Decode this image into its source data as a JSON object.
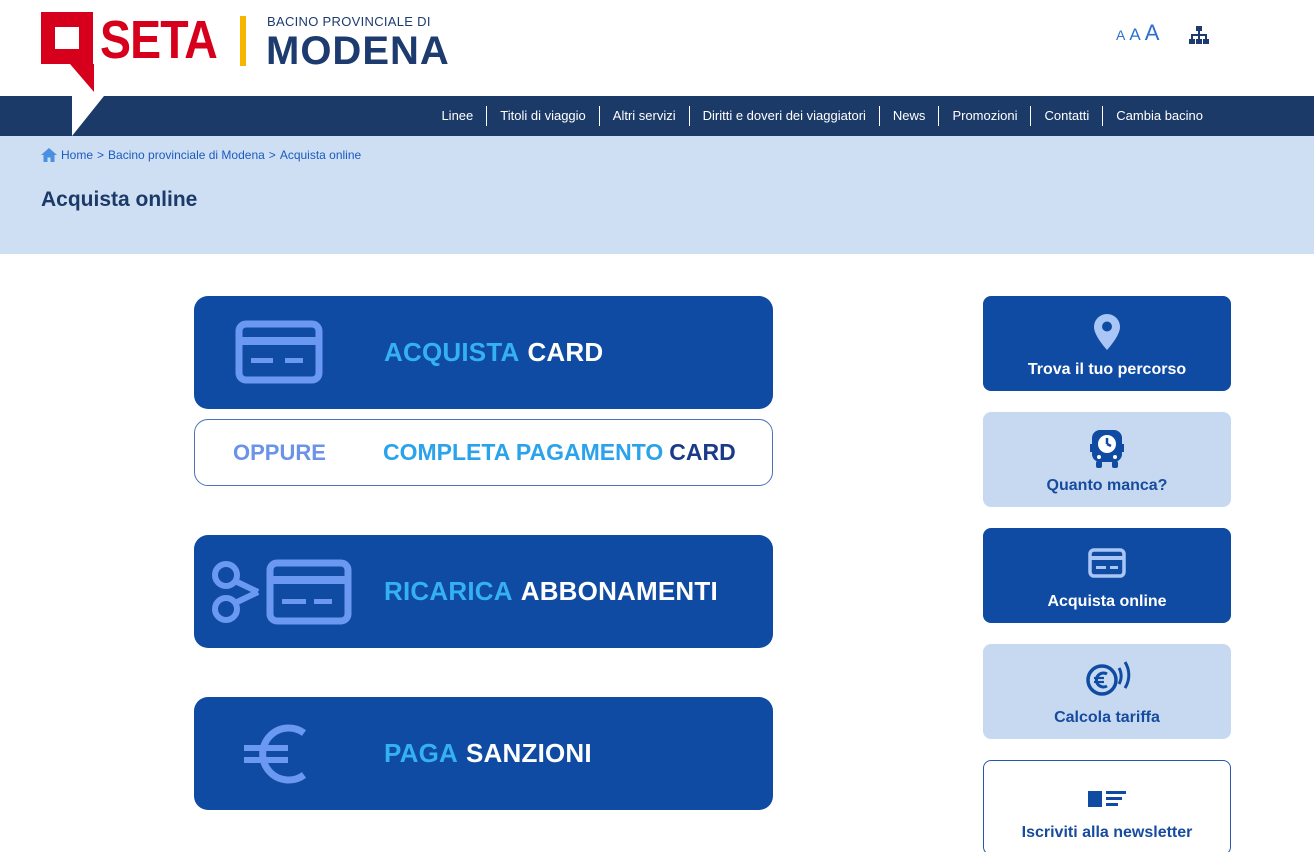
{
  "brand": {
    "name": "SETA",
    "subtitle": "BACINO PROVINCIALE DI",
    "city": "MODENA",
    "colors": {
      "red": "#d6001c",
      "yellow": "#f7b500",
      "navy": "#1b3a67",
      "blue": "#0f4ba3",
      "light_blue": "#35b0f0"
    }
  },
  "accessibility": {
    "font_small": "A",
    "font_medium": "A",
    "font_large": "A",
    "sitemap_icon": "sitemap-icon"
  },
  "nav": {
    "items": [
      {
        "label": "Linee"
      },
      {
        "label": "Titoli di viaggio"
      },
      {
        "label": "Altri servizi"
      },
      {
        "label": "Diritti e doveri dei viaggiatori"
      },
      {
        "label": "News"
      },
      {
        "label": "Promozioni"
      },
      {
        "label": "Contatti"
      },
      {
        "label": "Cambia bacino"
      }
    ]
  },
  "breadcrumb": {
    "home": "Home",
    "sep1": ">",
    "level1": "Bacino provinciale di Modena",
    "sep2": ">",
    "current": "Acquista online"
  },
  "page": {
    "title": "Acquista online"
  },
  "actions": {
    "buy_card": {
      "light": "ACQUISTA",
      "bold": "CARD",
      "icon": "credit-card-icon"
    },
    "complete_payment": {
      "prefix": "OPPURE",
      "light": "COMPLETA PAGAMENTO",
      "bold": "CARD"
    },
    "recharge": {
      "light": "RICARICA",
      "bold": "ABBONAMENTI",
      "icon": "scissors-card-icon"
    },
    "fines": {
      "light": "PAGA",
      "bold": "SANZIONI",
      "icon": "euro-icon"
    }
  },
  "side_widgets": [
    {
      "label": "Trova il tuo percorso",
      "icon": "map-pin-icon"
    },
    {
      "label": "Quanto manca?",
      "icon": "bus-clock-icon"
    },
    {
      "label": "Acquista online",
      "icon": "credit-card-icon"
    },
    {
      "label": "Calcola tariffa",
      "icon": "euro-contactless-icon"
    },
    {
      "label": "Iscriviti alla newsletter",
      "icon": "newsletter-icon"
    }
  ]
}
